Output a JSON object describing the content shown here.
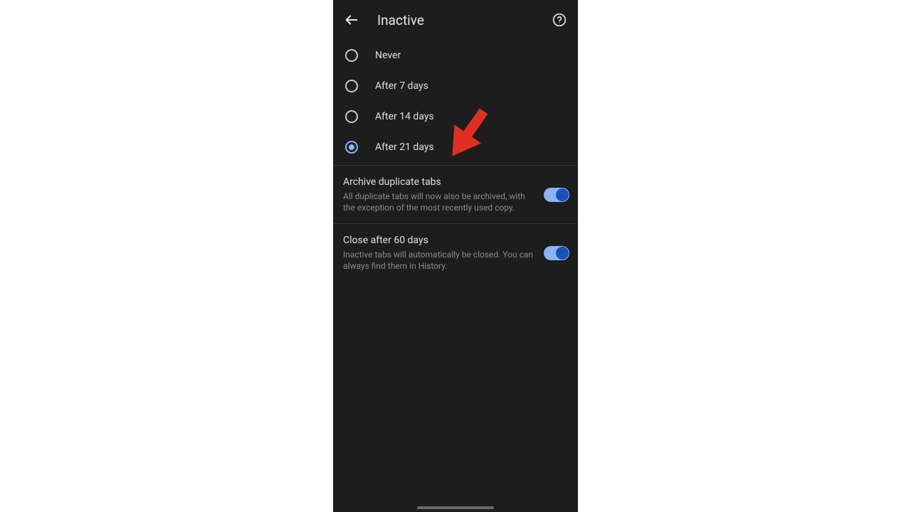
{
  "header": {
    "title": "Inactive"
  },
  "radio_options": [
    {
      "label": "Never",
      "selected": false
    },
    {
      "label": "After 7 days",
      "selected": false
    },
    {
      "label": "After 14 days",
      "selected": false
    },
    {
      "label": "After 21 days",
      "selected": true
    }
  ],
  "settings": [
    {
      "title": "Archive duplicate tabs",
      "description": "All duplicate tabs will now also be archived, with the exception of the most recently used copy.",
      "enabled": true
    },
    {
      "title": "Close after 60 days",
      "description": "Inactive tabs will automatically be closed. You can always find them in History.",
      "enabled": true
    }
  ]
}
